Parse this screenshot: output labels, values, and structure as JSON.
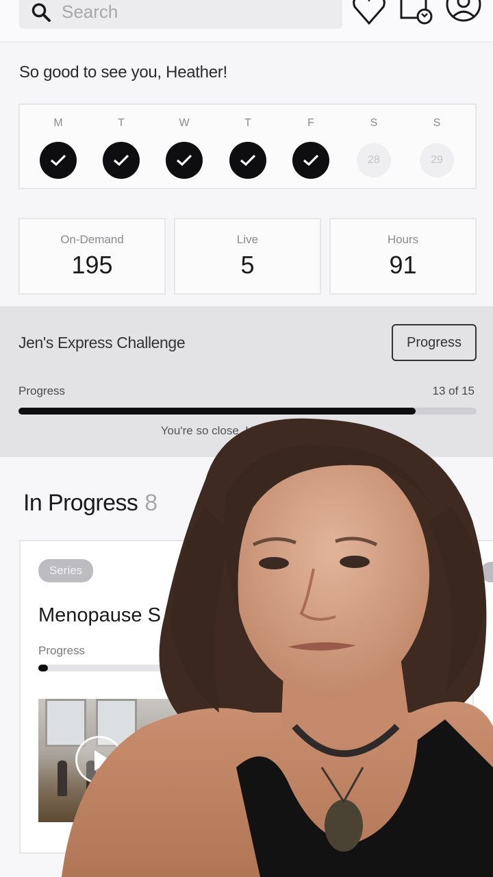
{
  "search": {
    "placeholder": "Search"
  },
  "header_icons": [
    "heart-icon",
    "schedule-refresh-icon",
    "profile-icon"
  ],
  "greeting": "So good to see you, Heather!",
  "week": [
    {
      "label": "M",
      "status": "done"
    },
    {
      "label": "T",
      "status": "done"
    },
    {
      "label": "W",
      "status": "done"
    },
    {
      "label": "T",
      "status": "done"
    },
    {
      "label": "F",
      "status": "done"
    },
    {
      "label": "S",
      "status": "upcoming",
      "date": "28"
    },
    {
      "label": "S",
      "status": "upcoming",
      "date": "29"
    }
  ],
  "stats": [
    {
      "label": "On-Demand",
      "value": "195"
    },
    {
      "label": "Live",
      "value": "5"
    },
    {
      "label": "Hours",
      "value": "91"
    }
  ],
  "challenge": {
    "title": "Jen's Express Challenge",
    "button_label": "Progress",
    "progress_label": "Progress",
    "progress_count": "13 of 15",
    "progress_fraction": 0.867,
    "message": "You're so close, Heather! Just 🔥"
  },
  "in_progress": {
    "title": "In Progress",
    "count": "8",
    "card": {
      "tag": "Series",
      "title": "Menopause S",
      "progress_label": "Progress",
      "progress_fraction": 0.05
    }
  },
  "colors": {
    "accent": "#0e0e10",
    "challenge_bg": "#e3e3e5",
    "page_bg": "#f6f6f8"
  }
}
